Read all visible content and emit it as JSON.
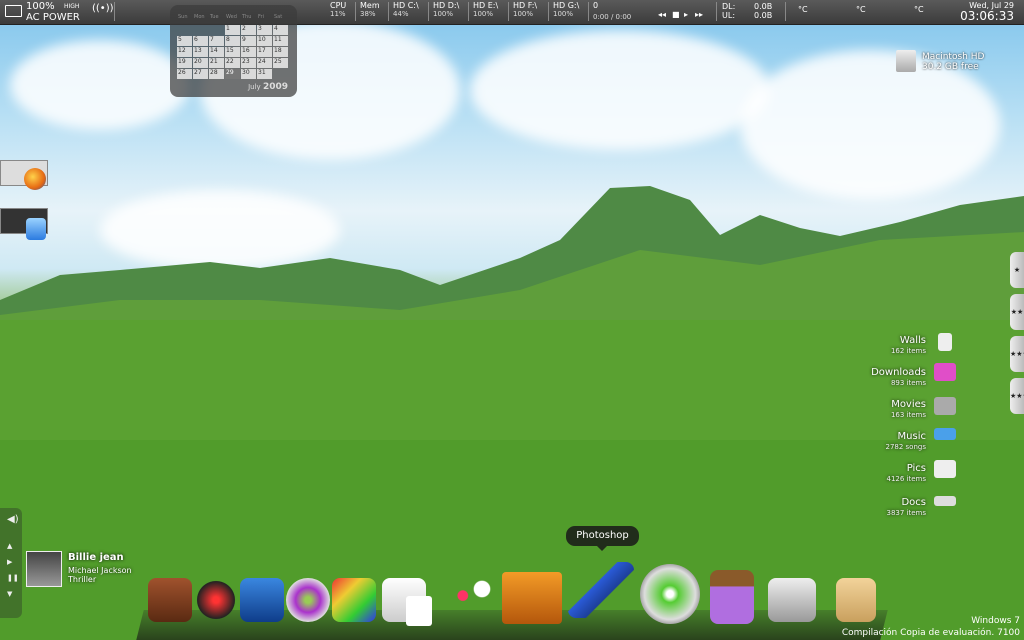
{
  "top_bar": {
    "power_pct": "100%",
    "power_label": "AC POWER",
    "signal_label": "HIGH",
    "meters": [
      {
        "label": "CPU",
        "value": "11%"
      },
      {
        "label": "Mem",
        "value": "38%"
      },
      {
        "label": "HD C:\\",
        "value": "44%"
      },
      {
        "label": "HD D:\\",
        "value": "100%"
      },
      {
        "label": "HD E:\\",
        "value": "100%"
      },
      {
        "label": "HD F:\\",
        "value": "100%"
      },
      {
        "label": "HD G:\\",
        "value": "100%"
      }
    ],
    "media_count": "0",
    "media_time": "0:00 / 0:00",
    "dl_label": "DL:",
    "dl_value": "0.0B",
    "ul_label": "UL:",
    "ul_value": "0.0B",
    "temps": [
      "°C",
      "°C",
      "°C"
    ],
    "date": "Wed, Jul 29",
    "time": "03:06:33"
  },
  "calendar": {
    "days": [
      "Sun",
      "Mon",
      "Tue",
      "Wed",
      "Thu",
      "Fri",
      "Sat"
    ],
    "weeks": [
      [
        "",
        "",
        "",
        "1",
        "2",
        "3",
        "4"
      ],
      [
        "5",
        "6",
        "7",
        "8",
        "9",
        "10",
        "11"
      ],
      [
        "12",
        "13",
        "14",
        "15",
        "16",
        "17",
        "18"
      ],
      [
        "19",
        "20",
        "21",
        "22",
        "23",
        "24",
        "25"
      ],
      [
        "26",
        "27",
        "28",
        "29",
        "30",
        "31",
        ""
      ]
    ],
    "month": "July",
    "year": "2009"
  },
  "drive": {
    "name": "Macintosh HD",
    "free": "30.2 GB free"
  },
  "stacks": [
    {
      "name": "Walls",
      "count": "162 items"
    },
    {
      "name": "Downloads",
      "count": "893 items"
    },
    {
      "name": "Movies",
      "count": "163 items"
    },
    {
      "name": "Music",
      "count": "2782 songs"
    },
    {
      "name": "Pics",
      "count": "4126 items"
    },
    {
      "name": "Docs",
      "count": "3837 items"
    }
  ],
  "right_tabs": [
    "★",
    "★★",
    "★★★",
    "★★★★"
  ],
  "now_playing": {
    "title": "Billie jean",
    "artist": "Michael Jackson",
    "album": "Thriller"
  },
  "dock": {
    "tooltip": "Photoshop",
    "items": [
      "Finder",
      "Audio",
      "Notifier",
      "iTunes",
      "Paint",
      "News",
      "Coffee",
      "Cocktail",
      "TV",
      "Photoshop",
      "Xbox 360",
      "Pencil",
      "Mail Truck",
      "Recycle"
    ]
  },
  "watermark": {
    "line1": "Windows 7",
    "line2": "Compilación Copia de evaluación. 7100"
  }
}
